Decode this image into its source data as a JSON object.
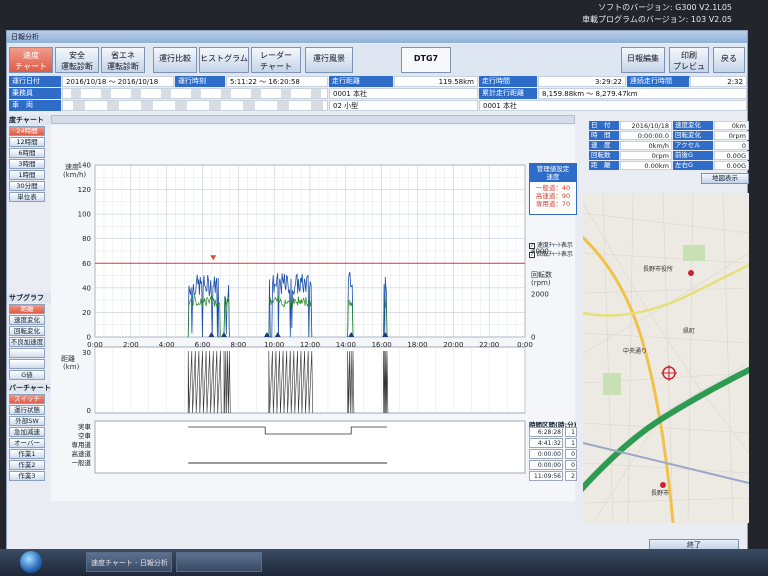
{
  "system": {
    "software_version": "ソフトのバージョン: G300 V2.1L05",
    "firmware_version": "車載プログラムのバージョン: 103 V2.05"
  },
  "window": {
    "title": "日報分析"
  },
  "toolbar": [
    {
      "label": "速度\nチャート",
      "active": true
    },
    {
      "label": "安全\n運転診断"
    },
    {
      "label": "省エネ\n運転診断"
    },
    {
      "label": "運行比較"
    },
    {
      "label": "ヒストグラム"
    },
    {
      "label": "レーダー\nチャート"
    },
    {
      "label": "運行風景"
    },
    {
      "label": "DTG7"
    },
    {
      "label": "日報編集"
    },
    {
      "label": "印刷\nプレビュー"
    },
    {
      "label": "戻る"
    }
  ],
  "info": {
    "date_label": "運行日付",
    "date_value": "2016/10/18 〜 2016/10/18",
    "time_label": "運行時刻",
    "time_value": "5:11:22 〜 16:20:58",
    "distance_label": "走行距離",
    "distance_value": "119.58km",
    "drive_time_label": "走行時間",
    "drive_time_value": "3:29:22",
    "continuous_label": "連続走行時間",
    "continuous_value": "2:32",
    "crew_label": "乗務員",
    "office1": "0001 本社",
    "cumulative_label": "累計走行距離",
    "cumulative_value": "8,159.88km 〜 8,279.47km",
    "vehicle_label": "車　両",
    "vehicle_type": "02 小型",
    "office2": "0001 本社"
  },
  "left_panel": {
    "chart_header": "度チャート",
    "range_buttons": [
      "24時間",
      "12時間",
      "6時間",
      "3時間",
      "1時間",
      "30分間",
      "単位表"
    ],
    "graph_header": "サブグラフ",
    "graph_buttons": [
      "距離",
      "速度変化",
      "回転変化",
      "不良加速度",
      "",
      ""
    ],
    "gvalue_button": "G値",
    "bar_header": "バーチャート",
    "bar_buttons": [
      "スイッチ",
      "運行状態",
      "外部SW",
      "急加減速",
      "オーバー",
      "作業1",
      "作業2",
      "作業3"
    ]
  },
  "chart": {
    "speed_unit": "速度\n(km/h)",
    "speed_ticks": [
      "140",
      "120",
      "100",
      "80",
      "60",
      "40",
      "20",
      "0"
    ],
    "rpm_unit": "回転数\n(rpm)",
    "rpm_ticks": [
      "4000",
      "2000",
      "0"
    ],
    "time_ticks": [
      "0:00",
      "2:00",
      "4:00",
      "6:00",
      "8:00",
      "10:00",
      "12:00",
      "14:00",
      "16:00",
      "18:00",
      "20:00",
      "22:00",
      "0:00"
    ],
    "dist_unit": "距離\n(km)",
    "dist_ticks": [
      "30",
      "0"
    ],
    "bar_rows": [
      "実車",
      "空車",
      "専用道",
      "高速道",
      "一般道"
    ],
    "speed_limit_kmh": 60,
    "markers_hours": [
      6.5,
      7.2,
      9.6,
      10.2,
      14.3,
      16.2
    ],
    "speed_blocks": [
      {
        "start": 5.2,
        "end": 7.0,
        "avg": 42
      },
      {
        "start": 7.2,
        "end": 7.5,
        "avg": 38
      },
      {
        "start": 9.7,
        "end": 12.1,
        "avg": 43
      },
      {
        "start": 14.1,
        "end": 14.4,
        "avg": 50
      },
      {
        "start": 16.1,
        "end": 16.3,
        "avg": 40
      }
    ],
    "settings": {
      "title": "管理値設定\n速度",
      "general": "一般道：40",
      "highway": "高速道：90",
      "dedicated": "専用道：70"
    },
    "checks": [
      "速度ﾁｬｰﾄ表示",
      "回転ﾁｬｰﾄ表示"
    ]
  },
  "interval": {
    "title": "時間区間(時:分)",
    "rows": [
      "6:28:28",
      "4:41:32",
      "0:00:00",
      "0:00:00",
      "11:09:56"
    ],
    "counts": [
      "1",
      "1",
      "0",
      "0",
      "2"
    ]
  },
  "stats": {
    "rows": [
      {
        "l1": "日　付",
        "v1": "2016/10/18",
        "l2": "速度変化",
        "v2": "0km"
      },
      {
        "l1": "時　間",
        "v1": "0:00:00.0",
        "l2": "回転変化",
        "v2": "0rpm"
      },
      {
        "l1": "速　度",
        "v1": "0km/h",
        "l2": "アクセル",
        "v2": "0"
      },
      {
        "l1": "回転数",
        "v1": "0rpm",
        "l2": "前後G",
        "v2": "0.00G"
      },
      {
        "l1": "距　離",
        "v1": "0.00km",
        "l2": "左右G",
        "v2": "0.00G"
      }
    ],
    "map_button": "地図表示"
  },
  "map": {
    "labels": [
      "長野市役所",
      "中央通り",
      "県町",
      "長野市"
    ]
  },
  "taskbar": {
    "item1": "速度チャート - 日報分析",
    "item2": "",
    "end_button": "終了"
  },
  "colors": {
    "speed_line": "#1a4fa8",
    "rpm_line": "#2a8a2a",
    "limit_line": "#d83a2a",
    "header_blue": "#2f6cc7",
    "button_red": "#de5c4a"
  }
}
